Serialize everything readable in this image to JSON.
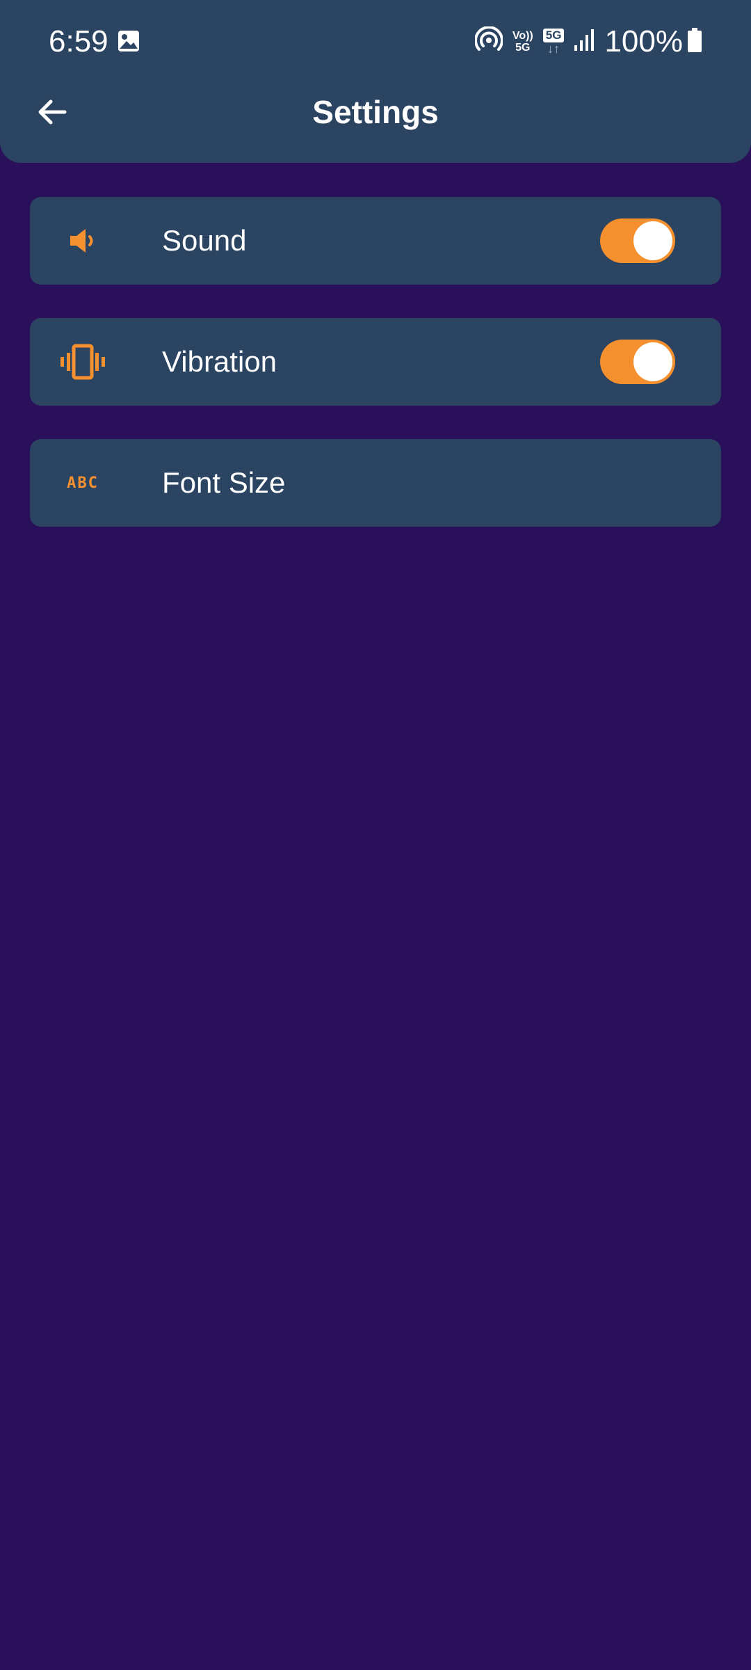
{
  "status_bar": {
    "time": "6:59",
    "battery_text": "100%",
    "volte_line1": "Vo))",
    "volte_line2": "5G",
    "network_badge": "5G",
    "network_arrows": "↓↑",
    "icons": [
      "gallery-icon",
      "hotspot-icon",
      "volte-icon",
      "5g-icon",
      "signal-icon",
      "battery-icon"
    ]
  },
  "app_bar": {
    "title": "Settings",
    "back_icon": "arrow-left-icon"
  },
  "settings": [
    {
      "label": "Sound",
      "icon": "speaker-icon",
      "toggle": true,
      "enabled": true
    },
    {
      "label": "Vibration",
      "icon": "vibration-icon",
      "toggle": true,
      "enabled": true
    },
    {
      "label": "Font Size",
      "icon": "abc-icon",
      "icon_text": "ABC",
      "toggle": false
    }
  ],
  "colors": {
    "background": "#2a0f5a",
    "panel": "#2b4462",
    "accent": "#f5902e",
    "text": "#ffffff"
  }
}
